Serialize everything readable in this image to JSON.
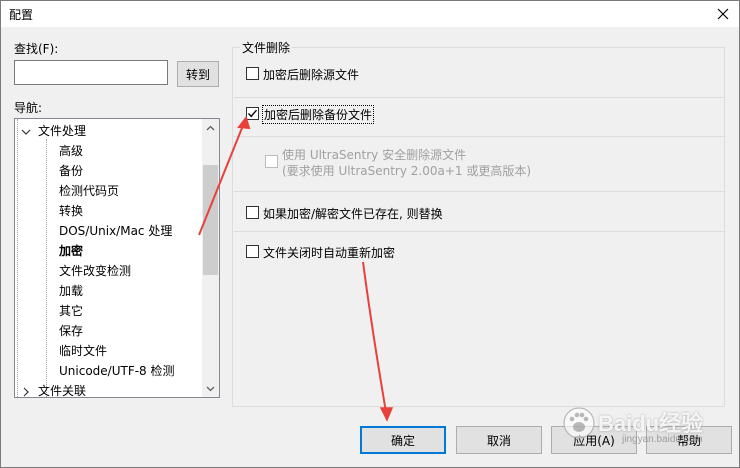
{
  "window": {
    "title": "配置"
  },
  "search": {
    "label": "查找(F):",
    "value": "",
    "goto_label": "转到"
  },
  "nav": {
    "label": "导航:",
    "items": [
      {
        "label": "文件处理",
        "level": 0,
        "expanded": true
      },
      {
        "label": "高级",
        "level": 1
      },
      {
        "label": "备份",
        "level": 1
      },
      {
        "label": "检测代码页",
        "level": 1
      },
      {
        "label": "转换",
        "level": 1
      },
      {
        "label": "DOS/Unix/Mac 处理",
        "level": 1
      },
      {
        "label": "加密",
        "level": 1,
        "selected": true
      },
      {
        "label": "文件改变检测",
        "level": 1
      },
      {
        "label": "加载",
        "level": 1
      },
      {
        "label": "其它",
        "level": 1
      },
      {
        "label": "保存",
        "level": 1
      },
      {
        "label": "临时文件",
        "level": 1
      },
      {
        "label": "Unicode/UTF-8 检测",
        "level": 1
      },
      {
        "label": "文件关联",
        "level": 0,
        "expanded": false
      }
    ]
  },
  "panel": {
    "group_title": "文件删除",
    "options": [
      {
        "label": "加密后删除源文件",
        "checked": false
      },
      {
        "label": "加密后删除备份文件",
        "checked": true
      },
      {
        "label": "使用 UltraSentry 安全删除源文件",
        "sub": "(要求使用 UltraSentry 2.00a+1 或更高版本)",
        "checked": false,
        "disabled": true
      },
      {
        "label": "如果加密/解密文件已存在, 则替换",
        "checked": false
      },
      {
        "label": "文件关闭时自动重新加密",
        "checked": false
      }
    ]
  },
  "buttons": {
    "ok": "确定",
    "cancel": "取消",
    "apply": "应用(A)",
    "help": "帮助"
  },
  "watermark": {
    "brand": "Baidu经验",
    "sub": "jingyan.baidu.com"
  },
  "colors": {
    "annotation": "#e8413a",
    "focus_border": "#0078d7"
  }
}
